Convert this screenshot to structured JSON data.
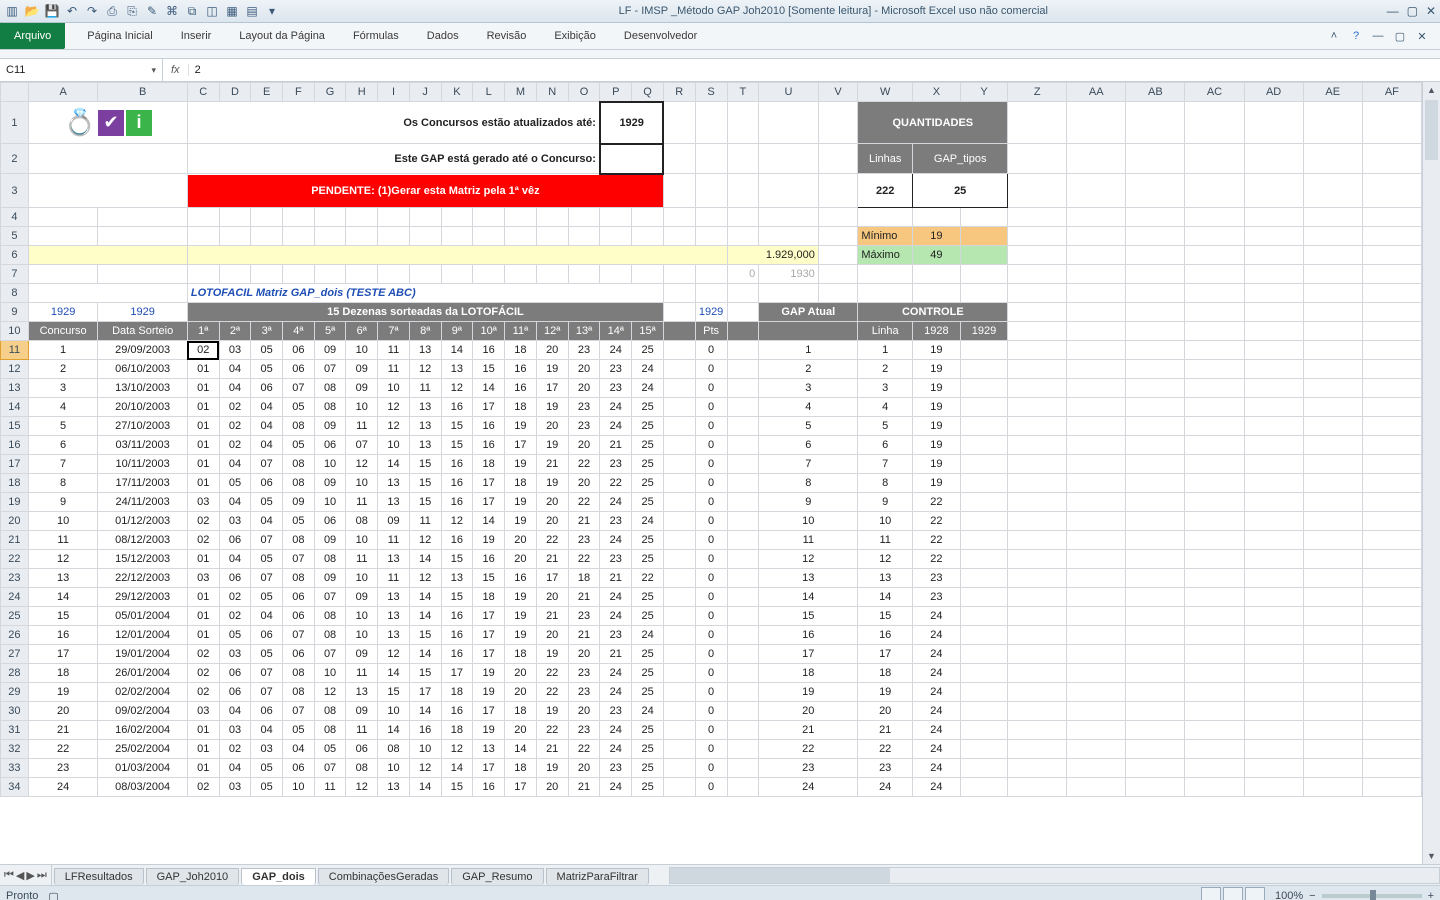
{
  "app": {
    "title": "LF - IMSP _Método GAP Joh2010  [Somente leitura]  -  Microsoft Excel uso não comercial"
  },
  "ribbon": {
    "file": "Arquivo",
    "tabs": [
      "Página Inicial",
      "Inserir",
      "Layout da Página",
      "Fórmulas",
      "Dados",
      "Revisão",
      "Exibição",
      "Desenvolvedor"
    ]
  },
  "formula_bar": {
    "name_box": "C11",
    "fx": "fx",
    "value": "2"
  },
  "banners": {
    "line1": "Os Concursos estão atualizados até:",
    "line1_val": "1929",
    "line2": "Este GAP está gerado até o Concurso:",
    "pending": "PENDENTE: (1)Gerar esta Matriz pela 1ª vêz",
    "quant_title": "QUANTIDADES",
    "quant_linhas_lbl": "Linhas",
    "quant_tipos_lbl": "GAP_tipos",
    "quant_linhas": "222",
    "quant_tipos": "25",
    "min_lbl": "Mínimo",
    "min_val": "19",
    "max_lbl": "Máximo",
    "max_val": "49",
    "row6_u": "1.929,000",
    "row7_u": "1930",
    "row7_t": "0",
    "matrix_title": "LOTOFACIL Matriz GAP_dois (TESTE ABC)"
  },
  "headers": {
    "a9": "1929",
    "b9": "1929",
    "mid9": "15 Dezenas sorteadas da LOTOFÁCIL",
    "r9": "1929",
    "gap_atual": "GAP Atual",
    "controle": "CONTROLE",
    "concurso": "Concurso",
    "data": "Data Sorteio",
    "dez": [
      "1ª",
      "2ª",
      "3ª",
      "4ª",
      "5ª",
      "6ª",
      "7ª",
      "8ª",
      "9ª",
      "10ª",
      "11ª",
      "12ª",
      "13ª",
      "14ª",
      "15ª"
    ],
    "pts": "Pts",
    "linha": "Linha",
    "c1928": "1928",
    "c1929": "1929"
  },
  "columns": [
    "A",
    "B",
    "C",
    "D",
    "E",
    "F",
    "G",
    "H",
    "I",
    "J",
    "K",
    "L",
    "M",
    "N",
    "O",
    "P",
    "Q",
    "R",
    "S",
    "T",
    "U",
    "V",
    "W",
    "X",
    "Y",
    "Z",
    "AA",
    "AB",
    "AC",
    "AD",
    "AE",
    "AF"
  ],
  "rows": [
    {
      "n": 1,
      "d": "29/09/2003",
      "v": [
        "02",
        "03",
        "05",
        "06",
        "09",
        "10",
        "11",
        "13",
        "14",
        "16",
        "18",
        "20",
        "23",
        "24",
        "25"
      ],
      "p": 0,
      "g": 1,
      "l": 1,
      "x": 19
    },
    {
      "n": 2,
      "d": "06/10/2003",
      "v": [
        "01",
        "04",
        "05",
        "06",
        "07",
        "09",
        "11",
        "12",
        "13",
        "15",
        "16",
        "19",
        "20",
        "23",
        "24"
      ],
      "p": 0,
      "g": 2,
      "l": 2,
      "x": 19
    },
    {
      "n": 3,
      "d": "13/10/2003",
      "v": [
        "01",
        "04",
        "06",
        "07",
        "08",
        "09",
        "10",
        "11",
        "12",
        "14",
        "16",
        "17",
        "20",
        "23",
        "24"
      ],
      "p": 0,
      "g": 3,
      "l": 3,
      "x": 19
    },
    {
      "n": 4,
      "d": "20/10/2003",
      "v": [
        "01",
        "02",
        "04",
        "05",
        "08",
        "10",
        "12",
        "13",
        "16",
        "17",
        "18",
        "19",
        "23",
        "24",
        "25"
      ],
      "p": 0,
      "g": 4,
      "l": 4,
      "x": 19
    },
    {
      "n": 5,
      "d": "27/10/2003",
      "v": [
        "01",
        "02",
        "04",
        "08",
        "09",
        "11",
        "12",
        "13",
        "15",
        "16",
        "19",
        "20",
        "23",
        "24",
        "25"
      ],
      "p": 0,
      "g": 5,
      "l": 5,
      "x": 19
    },
    {
      "n": 6,
      "d": "03/11/2003",
      "v": [
        "01",
        "02",
        "04",
        "05",
        "06",
        "07",
        "10",
        "13",
        "15",
        "16",
        "17",
        "19",
        "20",
        "21",
        "25"
      ],
      "p": 0,
      "g": 6,
      "l": 6,
      "x": 19
    },
    {
      "n": 7,
      "d": "10/11/2003",
      "v": [
        "01",
        "04",
        "07",
        "08",
        "10",
        "12",
        "14",
        "15",
        "16",
        "18",
        "19",
        "21",
        "22",
        "23",
        "25"
      ],
      "p": 0,
      "g": 7,
      "l": 7,
      "x": 19
    },
    {
      "n": 8,
      "d": "17/11/2003",
      "v": [
        "01",
        "05",
        "06",
        "08",
        "09",
        "10",
        "13",
        "15",
        "16",
        "17",
        "18",
        "19",
        "20",
        "22",
        "25"
      ],
      "p": 0,
      "g": 8,
      "l": 8,
      "x": 19
    },
    {
      "n": 9,
      "d": "24/11/2003",
      "v": [
        "03",
        "04",
        "05",
        "09",
        "10",
        "11",
        "13",
        "15",
        "16",
        "17",
        "19",
        "20",
        "22",
        "24",
        "25"
      ],
      "p": 0,
      "g": 9,
      "l": 9,
      "x": 22
    },
    {
      "n": 10,
      "d": "01/12/2003",
      "v": [
        "02",
        "03",
        "04",
        "05",
        "06",
        "08",
        "09",
        "11",
        "12",
        "14",
        "19",
        "20",
        "21",
        "23",
        "24"
      ],
      "p": 0,
      "g": 10,
      "l": 10,
      "x": 22
    },
    {
      "n": 11,
      "d": "08/12/2003",
      "v": [
        "02",
        "06",
        "07",
        "08",
        "09",
        "10",
        "11",
        "12",
        "16",
        "19",
        "20",
        "22",
        "23",
        "24",
        "25"
      ],
      "p": 0,
      "g": 11,
      "l": 11,
      "x": 22
    },
    {
      "n": 12,
      "d": "15/12/2003",
      "v": [
        "01",
        "04",
        "05",
        "07",
        "08",
        "11",
        "13",
        "14",
        "15",
        "16",
        "20",
        "21",
        "22",
        "23",
        "25"
      ],
      "p": 0,
      "g": 12,
      "l": 12,
      "x": 22
    },
    {
      "n": 13,
      "d": "22/12/2003",
      "v": [
        "03",
        "06",
        "07",
        "08",
        "09",
        "10",
        "11",
        "12",
        "13",
        "15",
        "16",
        "17",
        "18",
        "21",
        "22"
      ],
      "p": 0,
      "g": 13,
      "l": 13,
      "x": 23
    },
    {
      "n": 14,
      "d": "29/12/2003",
      "v": [
        "01",
        "02",
        "05",
        "06",
        "07",
        "09",
        "13",
        "14",
        "15",
        "18",
        "19",
        "20",
        "21",
        "24",
        "25"
      ],
      "p": 0,
      "g": 14,
      "l": 14,
      "x": 23
    },
    {
      "n": 15,
      "d": "05/01/2004",
      "v": [
        "01",
        "02",
        "04",
        "06",
        "08",
        "10",
        "13",
        "14",
        "16",
        "17",
        "19",
        "21",
        "23",
        "24",
        "25"
      ],
      "p": 0,
      "g": 15,
      "l": 15,
      "x": 24
    },
    {
      "n": 16,
      "d": "12/01/2004",
      "v": [
        "01",
        "05",
        "06",
        "07",
        "08",
        "10",
        "13",
        "15",
        "16",
        "17",
        "19",
        "20",
        "21",
        "23",
        "24"
      ],
      "p": 0,
      "g": 16,
      "l": 16,
      "x": 24
    },
    {
      "n": 17,
      "d": "19/01/2004",
      "v": [
        "02",
        "03",
        "05",
        "06",
        "07",
        "09",
        "12",
        "14",
        "16",
        "17",
        "18",
        "19",
        "20",
        "21",
        "25"
      ],
      "p": 0,
      "g": 17,
      "l": 17,
      "x": 24
    },
    {
      "n": 18,
      "d": "26/01/2004",
      "v": [
        "02",
        "06",
        "07",
        "08",
        "10",
        "11",
        "14",
        "15",
        "17",
        "19",
        "20",
        "22",
        "23",
        "24",
        "25"
      ],
      "p": 0,
      "g": 18,
      "l": 18,
      "x": 24
    },
    {
      "n": 19,
      "d": "02/02/2004",
      "v": [
        "02",
        "06",
        "07",
        "08",
        "12",
        "13",
        "15",
        "17",
        "18",
        "19",
        "20",
        "22",
        "23",
        "24",
        "25"
      ],
      "p": 0,
      "g": 19,
      "l": 19,
      "x": 24
    },
    {
      "n": 20,
      "d": "09/02/2004",
      "v": [
        "03",
        "04",
        "06",
        "07",
        "08",
        "09",
        "10",
        "14",
        "16",
        "17",
        "18",
        "19",
        "20",
        "23",
        "24"
      ],
      "p": 0,
      "g": 20,
      "l": 20,
      "x": 24
    },
    {
      "n": 21,
      "d": "16/02/2004",
      "v": [
        "01",
        "03",
        "04",
        "05",
        "08",
        "11",
        "14",
        "16",
        "18",
        "19",
        "20",
        "22",
        "23",
        "24",
        "25"
      ],
      "p": 0,
      "g": 21,
      "l": 21,
      "x": 24
    },
    {
      "n": 22,
      "d": "25/02/2004",
      "v": [
        "01",
        "02",
        "03",
        "04",
        "05",
        "06",
        "08",
        "10",
        "12",
        "13",
        "14",
        "21",
        "22",
        "24",
        "25"
      ],
      "p": 0,
      "g": 22,
      "l": 22,
      "x": 24
    },
    {
      "n": 23,
      "d": "01/03/2004",
      "v": [
        "01",
        "04",
        "05",
        "06",
        "07",
        "08",
        "10",
        "12",
        "14",
        "17",
        "18",
        "19",
        "20",
        "23",
        "25"
      ],
      "p": 0,
      "g": 23,
      "l": 23,
      "x": 24
    },
    {
      "n": 24,
      "d": "08/03/2004",
      "v": [
        "02",
        "03",
        "05",
        "10",
        "11",
        "12",
        "13",
        "14",
        "15",
        "16",
        "17",
        "20",
        "21",
        "24",
        "25"
      ],
      "p": 0,
      "g": 24,
      "l": 24,
      "x": 24
    }
  ],
  "sheet_tabs": [
    "LFResultados",
    "GAP_Joh2010",
    "GAP_dois",
    "CombinaçõesGeradas",
    "GAP_Resumo",
    "MatrizParaFiltrar"
  ],
  "sheet_active": 2,
  "status": {
    "ready": "Pronto",
    "zoom": "100%"
  }
}
